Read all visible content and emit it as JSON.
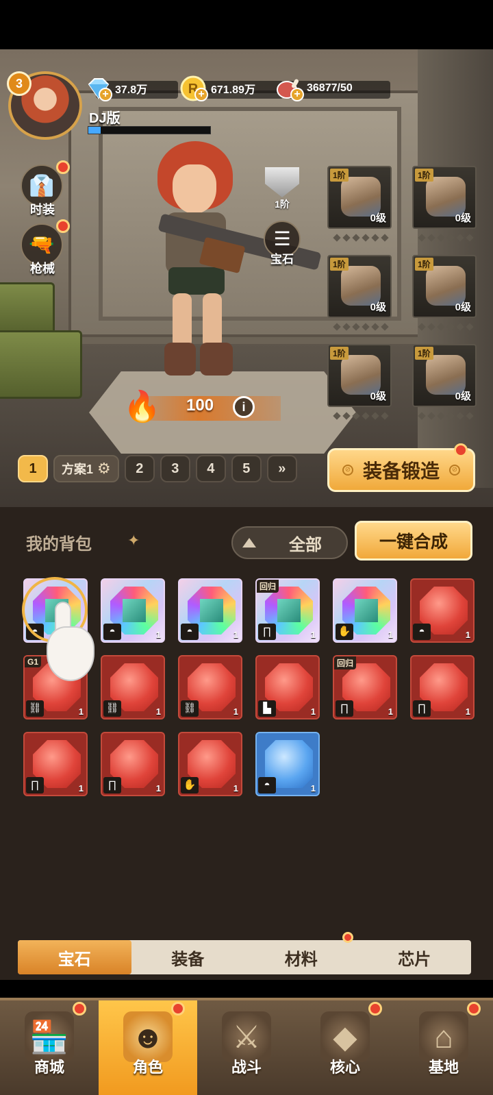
{
  "player": {
    "level": "3",
    "name": "DJ版",
    "exp_fraction": 0.1
  },
  "resources": [
    {
      "icon": "diamond-icon",
      "value": "37.8万"
    },
    {
      "icon": "coin-icon",
      "value": "671.89万"
    },
    {
      "icon": "meat-icon",
      "value": "36877/50"
    }
  ],
  "side_buttons": {
    "fashion_label": "时装",
    "weapon_label": "枪械"
  },
  "rank_label": "1阶",
  "gem_button_label": "宝石",
  "power_value": "100",
  "power_info_label": "i",
  "equipment": [
    {
      "tier": "1阶",
      "level": "0级",
      "icon": "helmet-icon"
    },
    {
      "tier": "1阶",
      "level": "0级",
      "icon": "gauntlet-icon"
    },
    {
      "tier": "1阶",
      "level": "0级",
      "icon": "armor-icon"
    },
    {
      "tier": "1阶",
      "level": "0级",
      "icon": "pants-icon"
    },
    {
      "tier": "1阶",
      "level": "0级",
      "icon": "boots-icon"
    },
    {
      "tier": "1阶",
      "level": "0级",
      "icon": "gloves-icon"
    }
  ],
  "loadouts": {
    "active": "1",
    "plan_label": "方案1",
    "others": [
      "2",
      "3",
      "4",
      "5"
    ],
    "more_label": "»"
  },
  "forge_button_label": "装备锻造",
  "bag": {
    "title": "我的背包",
    "filter_label": "全部",
    "merge_label": "一键合成",
    "items": [
      {
        "type": "rainbow",
        "tag": "",
        "part": "helmet",
        "part_glyph": "◓",
        "count": "1"
      },
      {
        "type": "rainbow",
        "tag": "",
        "part": "helmet",
        "part_glyph": "◓",
        "count": "1"
      },
      {
        "type": "rainbow",
        "tag": "",
        "part": "helmet",
        "part_glyph": "◓",
        "count": "1"
      },
      {
        "type": "rainbow",
        "tag": "回归",
        "part": "pants",
        "part_glyph": "∏",
        "count": "1"
      },
      {
        "type": "rainbow",
        "tag": "",
        "part": "glove",
        "part_glyph": "✋",
        "count": "1"
      },
      {
        "type": "red",
        "tag": "",
        "part": "helmet",
        "part_glyph": "◓",
        "count": "1"
      },
      {
        "type": "red",
        "tag": "G1",
        "part": "gauntlet",
        "part_glyph": "⛓",
        "count": "1"
      },
      {
        "type": "red",
        "tag": "",
        "part": "gauntlet",
        "part_glyph": "⛓",
        "count": "1"
      },
      {
        "type": "red",
        "tag": "",
        "part": "gauntlet",
        "part_glyph": "⛓",
        "count": "1"
      },
      {
        "type": "red",
        "tag": "",
        "part": "boot",
        "part_glyph": "▙",
        "count": "1"
      },
      {
        "type": "red",
        "tag": "回归",
        "part": "pants",
        "part_glyph": "∏",
        "count": "1"
      },
      {
        "type": "red",
        "tag": "",
        "part": "pants",
        "part_glyph": "∏",
        "count": "1"
      },
      {
        "type": "red",
        "tag": "",
        "part": "pants",
        "part_glyph": "∏",
        "count": "1"
      },
      {
        "type": "red",
        "tag": "",
        "part": "pants",
        "part_glyph": "∏",
        "count": "1"
      },
      {
        "type": "red",
        "tag": "",
        "part": "glove",
        "part_glyph": "✋",
        "count": "1"
      },
      {
        "type": "blue",
        "tag": "",
        "part": "helmet",
        "part_glyph": "◓",
        "count": "1"
      }
    ]
  },
  "category_tabs": [
    {
      "label": "宝石",
      "active": true
    },
    {
      "label": "装备",
      "active": false
    },
    {
      "label": "材料",
      "active": false
    },
    {
      "label": "芯片",
      "active": false
    }
  ],
  "bottom_nav": [
    {
      "label": "商城",
      "icon": "shop-icon",
      "glyph": "🏪",
      "active": false,
      "dot": true
    },
    {
      "label": "角色",
      "icon": "character-icon",
      "glyph": "☻",
      "active": true,
      "dot": true
    },
    {
      "label": "战斗",
      "icon": "battle-icon",
      "glyph": "⚔",
      "active": false,
      "dot": false
    },
    {
      "label": "核心",
      "icon": "core-icon",
      "glyph": "◆",
      "active": false,
      "dot": true
    },
    {
      "label": "基地",
      "icon": "base-icon",
      "glyph": "⌂",
      "active": false,
      "dot": true
    }
  ],
  "colors": {
    "accent": "#f2b94a",
    "panel": "#2a221c",
    "gem_red": "#e0443a",
    "gem_blue": "#5aa5f0"
  }
}
